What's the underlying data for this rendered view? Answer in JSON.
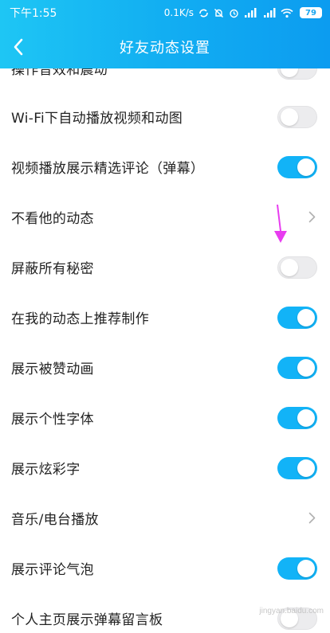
{
  "statusbar": {
    "time": "下午1:55",
    "speed": "0.1K/s",
    "battery": "79"
  },
  "navbar": {
    "title": "好友动态设置"
  },
  "settings": [
    {
      "label": "操作音效和震动",
      "control": "toggle",
      "state": "off"
    },
    {
      "label": "Wi-Fi下自动播放视频和动图",
      "control": "toggle",
      "state": "off"
    },
    {
      "label": "视频播放展示精选评论（弹幕）",
      "control": "toggle",
      "state": "on"
    },
    {
      "label": "不看他的动态",
      "control": "chevron"
    },
    {
      "label": "屏蔽所有秘密",
      "control": "toggle",
      "state": "off"
    },
    {
      "label": "在我的动态上推荐制作",
      "control": "toggle",
      "state": "on"
    },
    {
      "label": "展示被赞动画",
      "control": "toggle",
      "state": "on"
    },
    {
      "label": "展示个性字体",
      "control": "toggle",
      "state": "on"
    },
    {
      "label": "展示炫彩字",
      "control": "toggle",
      "state": "on"
    },
    {
      "label": "音乐/电台播放",
      "control": "chevron"
    },
    {
      "label": "展示评论气泡",
      "control": "toggle",
      "state": "on"
    },
    {
      "label": "个人主页展示弹幕留言板",
      "control": "toggle",
      "state": "off"
    }
  ],
  "watermark": "jingyan.baidu.com",
  "colors": {
    "accent": "#12b3f7",
    "annotation": "#e83cf0"
  }
}
